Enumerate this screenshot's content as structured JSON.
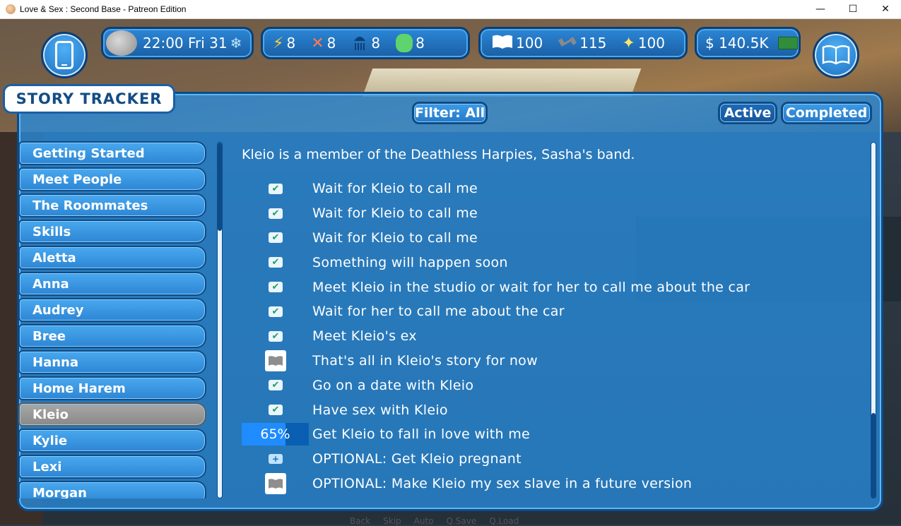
{
  "window": {
    "title": "Love & Sex : Second Base - Patreon Edition",
    "controls": {
      "minimize": "—",
      "maximize": "☐",
      "close": "✕"
    }
  },
  "hud": {
    "time": "22:00 Fri 31",
    "needs": [
      {
        "icon": "lightning-icon",
        "value": "8"
      },
      {
        "icon": "fork-knife-icon",
        "value": "8"
      },
      {
        "icon": "shower-icon",
        "value": "8"
      },
      {
        "icon": "mask-icon",
        "value": "8"
      }
    ],
    "stats": [
      {
        "icon": "book-icon",
        "value": "100"
      },
      {
        "icon": "dumbbell-icon",
        "value": "115"
      },
      {
        "icon": "sparkle-icon",
        "value": "100"
      }
    ],
    "money": "$ 140.5K"
  },
  "tracker": {
    "title": "STORY TRACKER",
    "filter_label": "Filter: All",
    "active_label": "Active",
    "completed_label": "Completed",
    "stories": [
      {
        "label": "Getting Started",
        "selected": false
      },
      {
        "label": "Meet People",
        "selected": false
      },
      {
        "label": "The Roommates",
        "selected": false
      },
      {
        "label": "Skills",
        "selected": false
      },
      {
        "label": "Aletta",
        "selected": false
      },
      {
        "label": "Anna",
        "selected": false
      },
      {
        "label": "Audrey",
        "selected": false
      },
      {
        "label": "Bree",
        "selected": false
      },
      {
        "label": "Hanna",
        "selected": false
      },
      {
        "label": "Home Harem",
        "selected": false
      },
      {
        "label": "Kleio",
        "selected": true
      },
      {
        "label": "Kylie",
        "selected": false
      },
      {
        "label": "Lexi",
        "selected": false
      },
      {
        "label": "Morgan",
        "selected": false
      }
    ],
    "description": "Kleio is a member of the Deathless Harpies, Sasha's band.",
    "steps": [
      {
        "status": "done",
        "text": "Wait for Kleio to call me"
      },
      {
        "status": "done",
        "text": "Wait for Kleio to call me"
      },
      {
        "status": "done",
        "text": "Wait for Kleio to call me"
      },
      {
        "status": "done",
        "text": "Something will happen soon"
      },
      {
        "status": "done",
        "text": "Meet Kleio in the studio or wait for her to call me about the car"
      },
      {
        "status": "done",
        "text": "Wait for her to call me about the car"
      },
      {
        "status": "done",
        "text": "Meet Kleio's ex"
      },
      {
        "status": "book",
        "text": "That's all in Kleio's story for now"
      },
      {
        "status": "done",
        "text": "Go on a date with Kleio"
      },
      {
        "status": "done",
        "text": "Have sex with Kleio"
      },
      {
        "status": "progress",
        "progress": 65,
        "progress_label": "65%",
        "text": "Get Kleio to fall in love with me"
      },
      {
        "status": "plus",
        "text": "OPTIONAL: Get Kleio pregnant"
      },
      {
        "status": "book",
        "text": "OPTIONAL: Make Kleio my sex slave in a future version"
      }
    ]
  },
  "quick_menu": [
    "Back",
    "Skip",
    "Auto",
    "Q.Save",
    "Q.Load"
  ]
}
